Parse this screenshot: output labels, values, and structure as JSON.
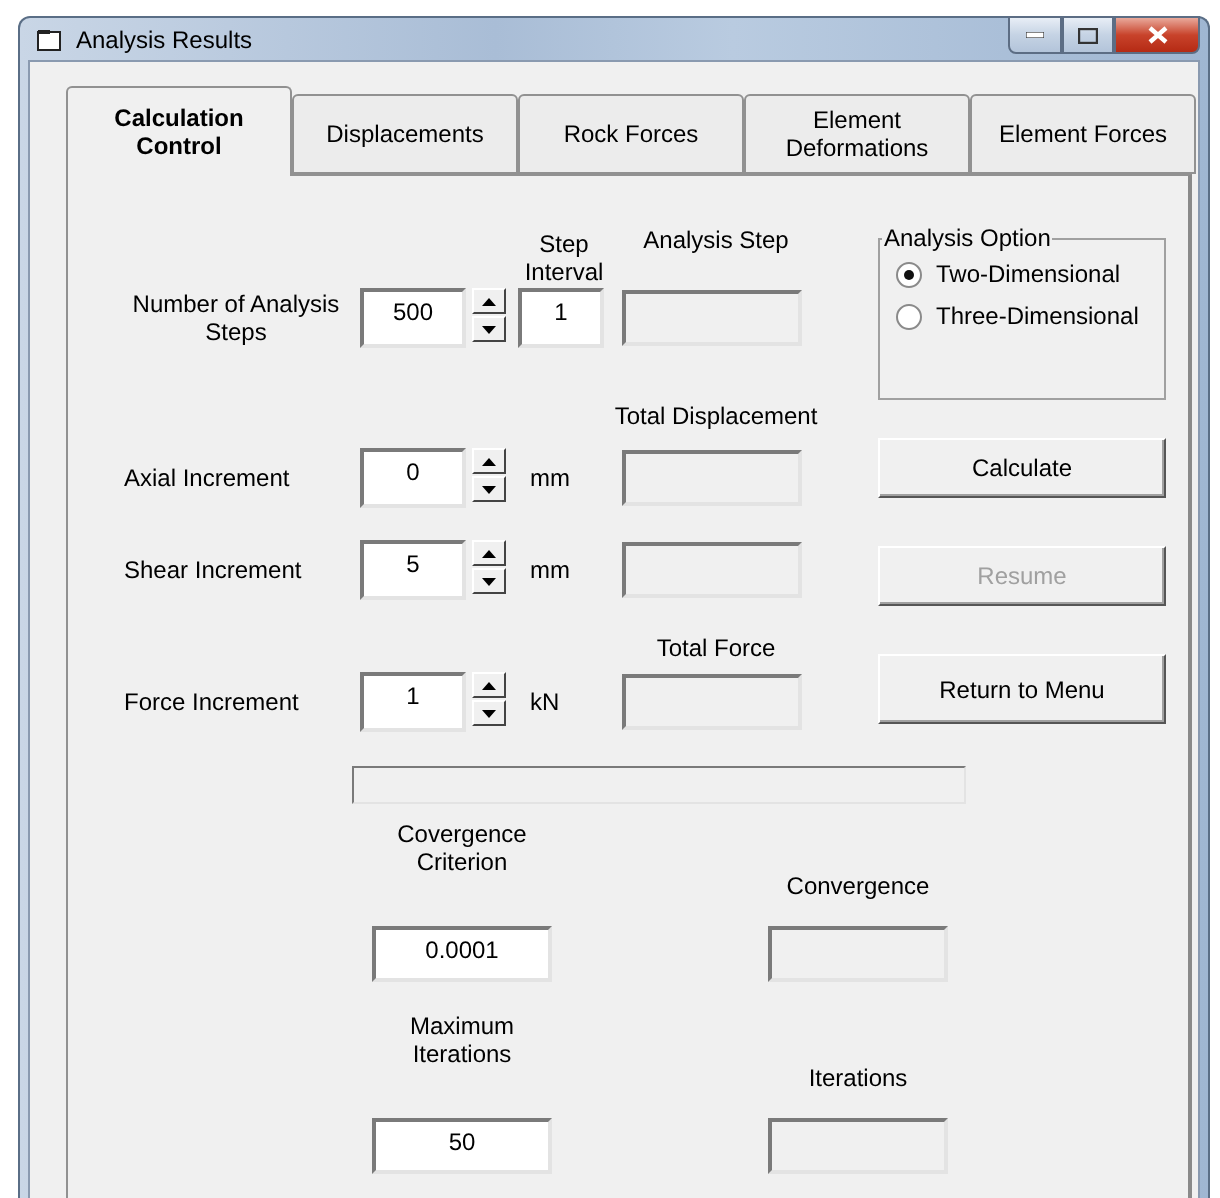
{
  "window": {
    "title": "Analysis Results"
  },
  "tabs": [
    {
      "label": "Calculation Control",
      "selected": true
    },
    {
      "label": "Displacements",
      "selected": false
    },
    {
      "label": "Rock Forces",
      "selected": false
    },
    {
      "label": "Element Deformations",
      "selected": false
    },
    {
      "label": "Element Forces",
      "selected": false
    }
  ],
  "analysis_steps": {
    "label": "Number of Analysis Steps",
    "value": "500"
  },
  "step_interval": {
    "label": "Step Interval",
    "value": "1"
  },
  "analysis_step": {
    "label": "Analysis Step"
  },
  "total_displacement": {
    "label": "Total Displacement"
  },
  "total_force": {
    "label": "Total Force"
  },
  "increments": [
    {
      "label": "Axial Increment",
      "value": "0",
      "unit": "mm"
    },
    {
      "label": "Shear Increment",
      "value": "5",
      "unit": "mm"
    },
    {
      "label": "Force Increment",
      "value": "1",
      "unit": "kN"
    }
  ],
  "analysis_option": {
    "title": "Analysis Option",
    "options": [
      {
        "label": "Two-Dimensional",
        "selected": true
      },
      {
        "label": "Three-Dimensional",
        "selected": false
      }
    ]
  },
  "buttons": [
    {
      "label": "Calculate",
      "disabled": false
    },
    {
      "label": "Resume",
      "disabled": true
    },
    {
      "label": "Return to Menu",
      "disabled": false
    }
  ],
  "progress": {
    "level": 0
  },
  "convergence_criterion": {
    "label": "Covergence Criterion",
    "value": "0.0001"
  },
  "maximum_iterations": {
    "label": "Maximum Iterations",
    "value": "50"
  },
  "convergence": {
    "label": "Convergence"
  },
  "iterations": {
    "label": "Iterations"
  }
}
